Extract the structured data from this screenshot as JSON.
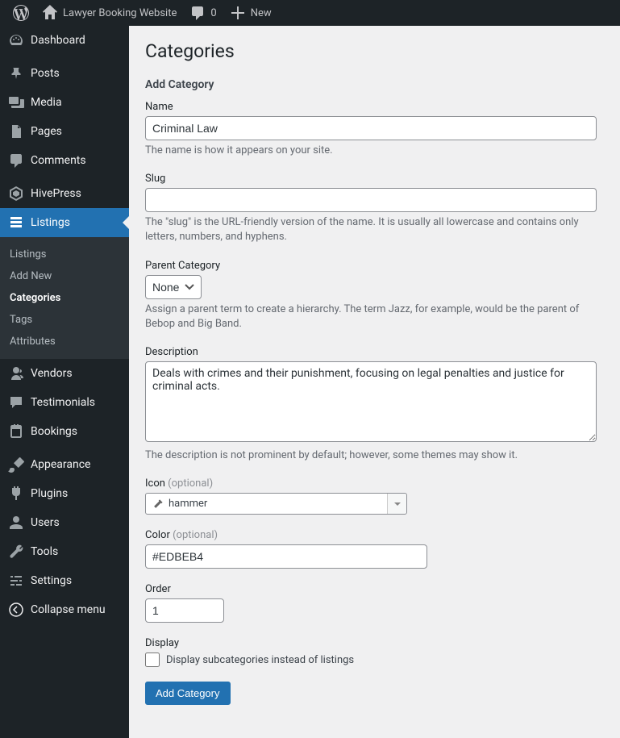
{
  "adminBar": {
    "siteName": "Lawyer Booking Website",
    "commentCount": "0",
    "newLabel": "New"
  },
  "sidebar": {
    "dashboard": "Dashboard",
    "posts": "Posts",
    "media": "Media",
    "pages": "Pages",
    "comments": "Comments",
    "hivepress": "HivePress",
    "listings": "Listings",
    "vendors": "Vendors",
    "testimonials": "Testimonials",
    "bookings": "Bookings",
    "appearance": "Appearance",
    "plugins": "Plugins",
    "users": "Users",
    "tools": "Tools",
    "settings": "Settings",
    "collapse": "Collapse menu"
  },
  "submenu": {
    "listings": "Listings",
    "addNew": "Add New",
    "categories": "Categories",
    "tags": "Tags",
    "attributes": "Attributes"
  },
  "page": {
    "title": "Categories",
    "subtitle": "Add Category"
  },
  "fields": {
    "name": {
      "label": "Name",
      "value": "Criminal Law",
      "desc": "The name is how it appears on your site."
    },
    "slug": {
      "label": "Slug",
      "value": "",
      "desc": "The \"slug\" is the URL-friendly version of the name. It is usually all lowercase and contains only letters, numbers, and hyphens."
    },
    "parent": {
      "label": "Parent Category",
      "selected": "None",
      "desc": "Assign a parent term to create a hierarchy. The term Jazz, for example, would be the parent of Bebop and Big Band."
    },
    "description": {
      "label": "Description",
      "value": "Deals with crimes and their punishment, focusing on legal penalties and justice for criminal acts.",
      "desc": "The description is not prominent by default; however, some themes may show it."
    },
    "icon": {
      "label": "Icon",
      "optional": "(optional)",
      "value": "hammer"
    },
    "color": {
      "label": "Color",
      "optional": "(optional)",
      "value": "#EDBEB4"
    },
    "order": {
      "label": "Order",
      "value": "1"
    },
    "display": {
      "label": "Display",
      "checkboxLabel": "Display subcategories instead of listings"
    },
    "submit": "Add Category"
  }
}
